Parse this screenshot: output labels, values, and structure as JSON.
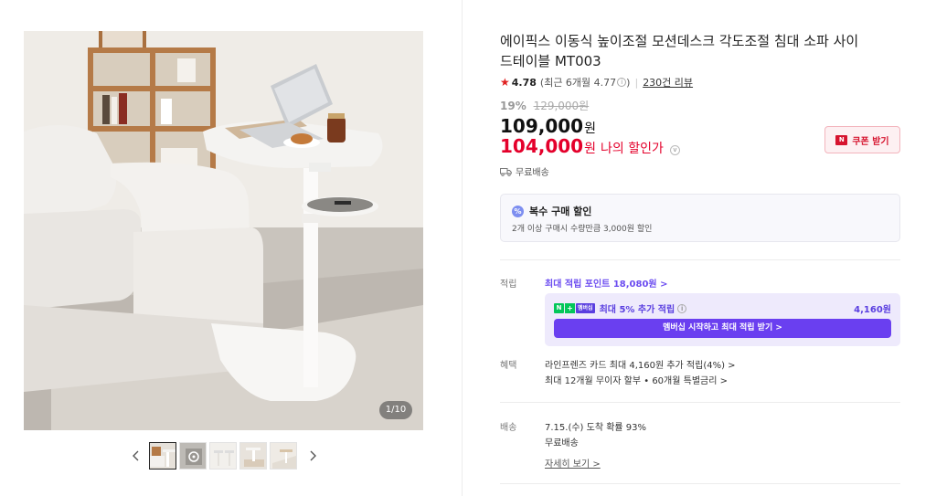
{
  "gallery": {
    "counter": "1/10",
    "prev_label": "‹",
    "next_label": "›",
    "thumb_count": 5
  },
  "product": {
    "title": "에이픽스 이동식 높이조절 모션데스크 각도조절 침대 소파 사이드테이블 MT003",
    "rating": {
      "score": "4.78",
      "recent": "(최근 6개월 4.77",
      "recent_close": ")",
      "reviews": "230건 리뷰"
    },
    "discount_rate": "19%",
    "original_price": "129,000원",
    "price": "109,000",
    "price_unit": "원",
    "my_price": "104,000",
    "my_price_unit": "원",
    "my_price_label": "나의 할인가",
    "coupon_button": "쿠폰 받기",
    "shipping_badge": "무료배송"
  },
  "multi_discount": {
    "title": "복수 구매 할인",
    "description": "2개 이상 구매시 수량만큼 3,000원 할인"
  },
  "points": {
    "label": "적립",
    "max_points": "최대 적립 포인트 18,080원 >",
    "membership_line": "최대 5% 추가 적립",
    "membership_amount": "4,160원",
    "membership_badge": "멤버십",
    "membership_button": "멤버십 시작하고 최대 적립 받기 >"
  },
  "benefits": {
    "label": "혜택",
    "items": [
      "라인프렌즈 카드 최대 4,160원 추가 적립(4%) >",
      "최대 12개월 무이자 할부 • 60개월 특별금리 >"
    ]
  },
  "delivery": {
    "label": "배송",
    "arrival": "7.15.(수) 도착 확률 93%",
    "fee": "무료배송",
    "detail_link": "자세히 보기 >"
  }
}
